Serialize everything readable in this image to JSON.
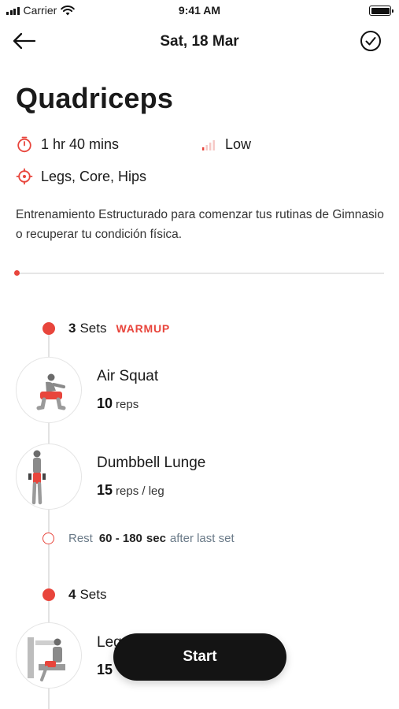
{
  "status_bar": {
    "carrier": "Carrier",
    "time": "9:41 AM"
  },
  "nav": {
    "title": "Sat, 18 Mar"
  },
  "workout": {
    "title": "Quadriceps",
    "duration": "1 hr 40 mins",
    "intensity": "Low",
    "targets": "Legs, Core, Hips",
    "description": "Entrenamiento Estructurado para comenzar tus rutinas de Gimnasio o recuperar tu condición física."
  },
  "groups": [
    {
      "sets_count": "3",
      "sets_word": "Sets",
      "tag": "WARMUP",
      "exercises": [
        {
          "name": "Air Squat",
          "reps": "10",
          "unit": "reps"
        },
        {
          "name": "Dumbbell Lunge",
          "reps": "15",
          "unit": "reps / leg"
        }
      ],
      "rest": {
        "label": "Rest",
        "range": "60 - 180",
        "unit": "sec",
        "suffix": "after last set"
      }
    },
    {
      "sets_count": "4",
      "sets_word": "Sets",
      "exercises": [
        {
          "name": "Leg",
          "reps": "15",
          "unit": ""
        }
      ]
    }
  ],
  "start_button": {
    "label": "Start"
  },
  "colors": {
    "accent": "#e8453c",
    "button": "#141414",
    "muted": "#6a7a88"
  }
}
